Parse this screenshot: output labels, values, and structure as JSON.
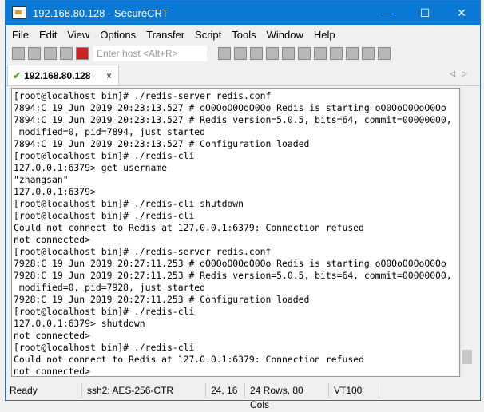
{
  "window": {
    "title": "192.168.80.128 - SecureCRT",
    "minimize": "—",
    "maximize": "☐",
    "close": "✕"
  },
  "menu": [
    "File",
    "Edit",
    "View",
    "Options",
    "Transfer",
    "Script",
    "Tools",
    "Window",
    "Help"
  ],
  "toolbar": {
    "host_placeholder": "Enter host <Alt+R>"
  },
  "tab": {
    "label": "192.168.80.128",
    "close": "×",
    "arrows": "◁▷"
  },
  "terminal": {
    "lines": [
      "[root@localhost bin]# ./redis-server redis.conf",
      "7894:C 19 Jun 2019 20:23:13.527 # oO0OoO0OoO0Oo Redis is starting oO0OoO0OoO0Oo",
      "7894:C 19 Jun 2019 20:23:13.527 # Redis version=5.0.5, bits=64, commit=00000000,",
      " modified=0, pid=7894, just started",
      "7894:C 19 Jun 2019 20:23:13.527 # Configuration loaded",
      "[root@localhost bin]# ./redis-cli",
      "127.0.0.1:6379> get username",
      "\"zhangsan\"",
      "127.0.0.1:6379>",
      "[root@localhost bin]# ./redis-cli shutdown",
      "[root@localhost bin]# ./redis-cli",
      "Could not connect to Redis at 127.0.0.1:6379: Connection refused",
      "not connected>",
      "[root@localhost bin]# ./redis-server redis.conf",
      "7928:C 19 Jun 2019 20:27:11.253 # oO0OoO0OoO0Oo Redis is starting oO0OoO0OoO0Oo",
      "7928:C 19 Jun 2019 20:27:11.253 # Redis version=5.0.5, bits=64, commit=00000000,",
      " modified=0, pid=7928, just started",
      "7928:C 19 Jun 2019 20:27:11.253 # Configuration loaded",
      "[root@localhost bin]# ./redis-cli",
      "127.0.0.1:6379> shutdown",
      "not connected>",
      "[root@localhost bin]# ./redis-cli",
      "Could not connect to Redis at 127.0.0.1:6379: Connection refused",
      "not connected>"
    ]
  },
  "status": {
    "ready": "Ready",
    "cipher": "ssh2: AES-256-CTR",
    "cursor": "24,  16",
    "size": "24 Rows, 80 Cols",
    "emulation": "VT100"
  }
}
